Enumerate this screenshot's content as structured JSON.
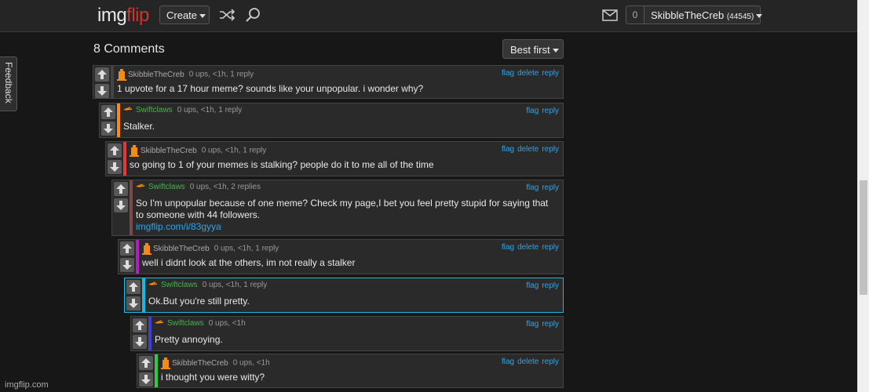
{
  "header": {
    "logo_img": "img",
    "logo_flip": "flip",
    "create_label": "Create",
    "notif_count": "0",
    "username": "SkibbleTheCreb",
    "points": "(44545)"
  },
  "feedback_label": "Feedback",
  "comments": {
    "title": "8 Comments",
    "sort_label": "Best first",
    "items": [
      {
        "user": "SkibbleTheCreb",
        "meta": "0 ups, <1h, 1 reply",
        "text": "1 upvote for a 17 hour meme? sounds like your unpopular. i wonder why?",
        "actions": [
          "flag",
          "delete",
          "reply"
        ],
        "bar_color": "#444444"
      },
      {
        "user": "Swiftclaws",
        "meta": "0 ups, <1h, 1 reply",
        "text": "Stalker.",
        "actions": [
          "flag",
          "reply"
        ],
        "bar_color": "#ff8c00"
      },
      {
        "user": "SkibbleTheCreb",
        "meta": "0 ups, <1h, 1 reply",
        "text": "so going to 1 of your memes is stalking? people do it to me all of the time",
        "actions": [
          "flag",
          "delete",
          "reply"
        ],
        "bar_color": "#e0393e"
      },
      {
        "user": "Swiftclaws",
        "meta": "0 ups, <1h, 2 replies",
        "text": "So I'm unpopular because of one meme? Check my page,I bet you feel pretty stupid for saying that to someone with 44 followers.",
        "link": "imgflip.com/i/83gyya",
        "actions": [
          "flag",
          "reply"
        ],
        "bar_color": "#7a4a4a"
      },
      {
        "user": "SkibbleTheCreb",
        "meta": "0 ups, <1h, 1 reply",
        "text": "well i didnt look at the others, im not really a stalker",
        "actions": [
          "flag",
          "delete",
          "reply"
        ],
        "bar_color": "#b71cc4"
      },
      {
        "user": "Swiftclaws",
        "meta": "0 ups, <1h, 1 reply",
        "text": "Ok.But you're still pretty.",
        "actions": [
          "flag",
          "reply"
        ],
        "bar_color": "#1eb7e0"
      },
      {
        "user": "Swiftclaws",
        "meta": "0 ups, <1h",
        "text": "Pretty annoying.",
        "actions": [
          "flag",
          "reply"
        ],
        "bar_color": "#3f3fd6"
      },
      {
        "user": "SkibbleTheCreb",
        "meta": "0 ups, <1h",
        "text": "i thought you were witty?",
        "actions": [
          "flag",
          "delete",
          "reply"
        ],
        "bar_color": "#2ecc40"
      }
    ]
  },
  "footer": "imgflip.com",
  "colors": {
    "accent_link": "#2fa3e6",
    "logo_red": "#d0342c",
    "username_green": "#4caf50"
  }
}
